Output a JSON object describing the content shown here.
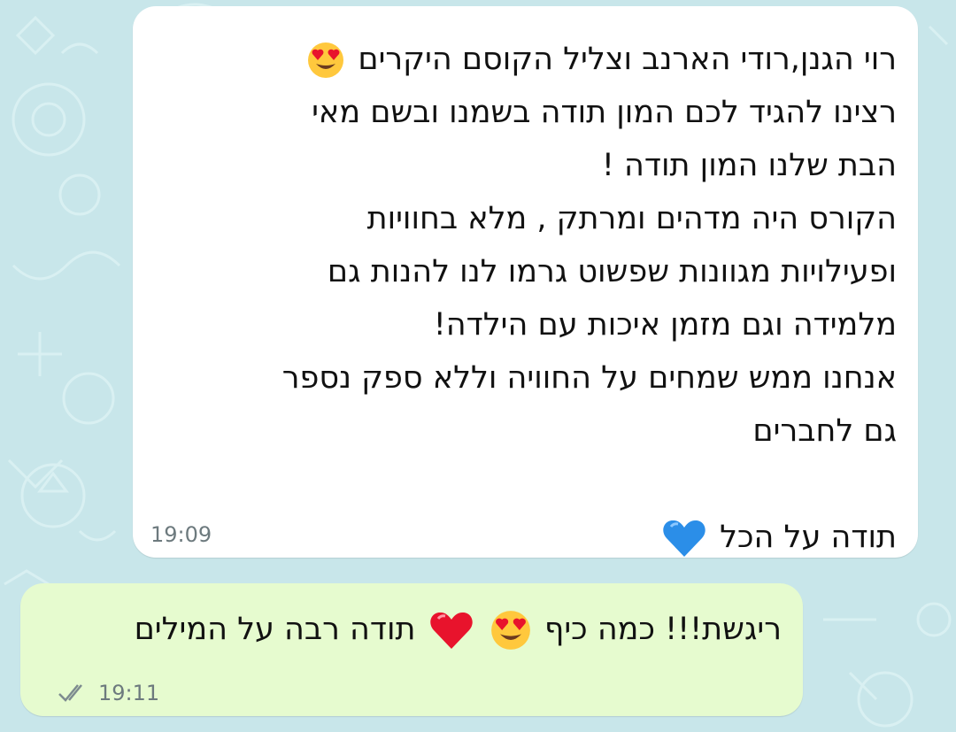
{
  "incoming_message": {
    "lines": [
      "רוי הגנן,רודי הארנב וצליל הקוסם היקרים",
      "רצינו להגיד לכם המון תודה בשמנו ובשם מאי",
      "הבת שלנו המון תודה !",
      "הקורס היה מדהים ומרתק , מלא בחוויות",
      "ופעילויות מגוונות שפשוט גרמו לנו להנות גם",
      "מלמידה וגם מזמן איכות עם הילדה!",
      "אנחנו ממש שמחים על החוויה וללא ספק נספר",
      "גם לחברים",
      "",
      "תודה על הכל"
    ],
    "time": "19:09",
    "emoji": [
      "heart-eyes-emoji",
      "blue-heart-emoji"
    ]
  },
  "outgoing_message": {
    "text_start": "ריגשת!!! כמה כיף",
    "text_end": "תודה רבה על המילים",
    "time": "19:11",
    "status": "read",
    "emoji": [
      "heart-eyes-emoji",
      "red-heart-emoji"
    ]
  },
  "colors": {
    "wallpaper": "#c8e6ea",
    "incoming_bubble": "#ffffff",
    "outgoing_bubble": "#e6fbcf",
    "text": "#111111",
    "meta": "#6d7a7e",
    "blue_heart": "#2b8ee8",
    "red_heart": "#e8132c"
  }
}
